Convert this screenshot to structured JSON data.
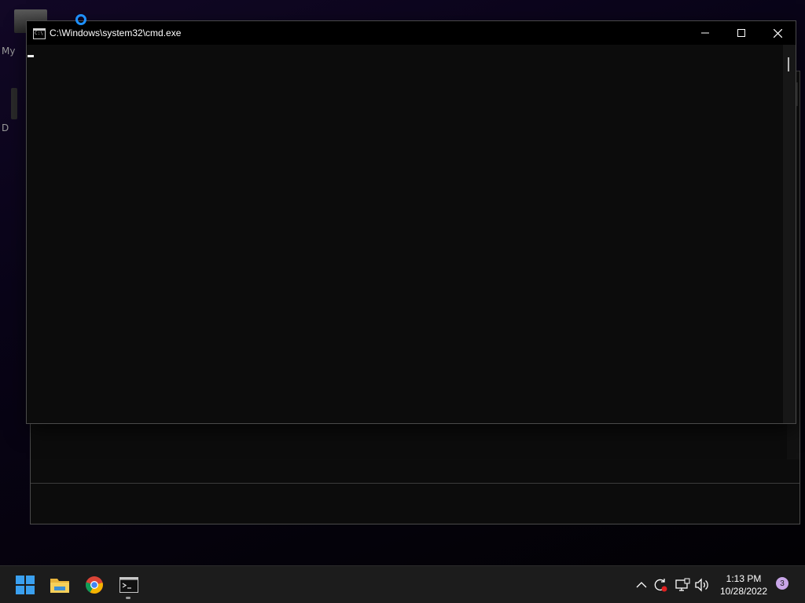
{
  "window": {
    "title": "C:\\Windows\\system32\\cmd.exe",
    "minimize_icon": "minimize-icon",
    "maximize_icon": "maximize-icon",
    "close_icon": "close-icon"
  },
  "desktop": {
    "icons": [
      {
        "label": "My",
        "icon": "desktop-shortcut-icon"
      },
      {
        "label": "D",
        "icon": "desktop-shortcut-icon"
      }
    ]
  },
  "taskbar": {
    "apps": [
      {
        "name": "Start",
        "icon": "windows-start-icon"
      },
      {
        "name": "File Explorer",
        "icon": "folder-icon"
      },
      {
        "name": "Google Chrome",
        "icon": "chrome-icon"
      },
      {
        "name": "Command Prompt",
        "icon": "cmd-icon",
        "active": true
      }
    ],
    "tray": {
      "icons": [
        "chevron-up-icon",
        "sync-icon",
        "network-icon",
        "volume-icon"
      ],
      "time": "1:13 PM",
      "date": "10/28/2022",
      "notification_count": "3"
    }
  },
  "colors": {
    "accent": "#1e90ff",
    "console_bg": "#0c0c0c",
    "taskbar_bg": "#1c1c1c",
    "badge": "#c9a6e8"
  }
}
